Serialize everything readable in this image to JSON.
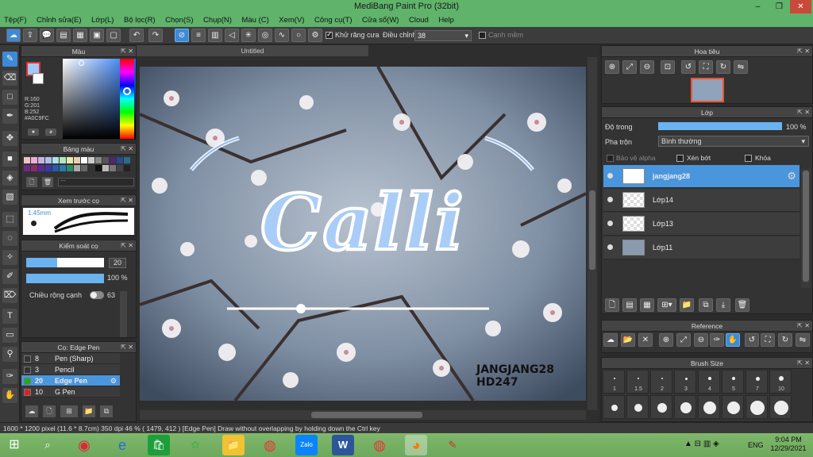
{
  "titlebar": {
    "title": "MediBang Paint Pro (32bit)",
    "minimize": "–",
    "maximize": "❐",
    "close": "✕"
  },
  "menu": [
    "Tệp(F)",
    "Chỉnh sửa(E)",
    "Lớp(L)",
    "Bộ lọc(R)",
    "Chọn(S)",
    "Chụp(N)",
    "Màu (C)",
    "Xem(V)",
    "Công cụ(T)",
    "Cửa sổ(W)",
    "Cloud",
    "Help"
  ],
  "toolbar": {
    "antialias_label": "Khử răng cưa",
    "adjust_label": "Điều chỉnh",
    "adjust_value": "38",
    "smooth_label": "Cạnh mềm"
  },
  "color_panel": {
    "title": "Màu",
    "r": "R:160",
    "g": "G:201",
    "b": "B:252",
    "hex": "#A0C9FC",
    "accent": "#a0c9fc"
  },
  "palette_panel": {
    "title": "Bảng màu"
  },
  "preview_panel": {
    "title": "Xem trước cọ",
    "size": "1.45mm"
  },
  "control_panel": {
    "title": "Kiểm soát cọ",
    "size_value": "20",
    "opacity_value": "100 %",
    "width_label": "Chiều rộng cạnh",
    "width_value": "63"
  },
  "brush_panel": {
    "title": "Cọ: Edge Pen",
    "items": [
      {
        "num": "8",
        "name": "Pen (Sharp)",
        "color": "#333333"
      },
      {
        "num": "3",
        "name": "Pencil",
        "color": "#333333"
      },
      {
        "num": "20",
        "name": "Edge Pen",
        "color": "#22aa22"
      },
      {
        "num": "10",
        "name": "G Pen",
        "color": "#dd2222"
      }
    ]
  },
  "document": {
    "tab": "Untitled"
  },
  "artwork": {
    "title": "Calli",
    "watermark_line1": "JANGJANG28",
    "watermark_line2": "HD247"
  },
  "navigator": {
    "title": "Hoa tiêu"
  },
  "layer_panel": {
    "title": "Lớp",
    "opacity_label": "Độ trong",
    "opacity_value": "100 %",
    "blend_label": "Pha trộn",
    "blend_value": "Bình thường",
    "protect_alpha": "Bảo vệ alpha",
    "clip": "Xén bớt",
    "lock": "Khóa",
    "layers": [
      {
        "name": "jangjang28"
      },
      {
        "name": "Lớp14"
      },
      {
        "name": "Lớp13"
      },
      {
        "name": "Lớp11"
      }
    ]
  },
  "reference_panel": {
    "title": "Reference"
  },
  "brush_size_panel": {
    "title": "Brush Size",
    "labels": [
      "1",
      "1.5",
      "2",
      "3",
      "4",
      "5",
      "7",
      "10"
    ]
  },
  "status": {
    "text": "1600 * 1200 pixel   (11.6 * 8.7cm)   350 dpi   46 %   ( 1479, 412 )   [Edge Pen] Draw without overlapping by holding down the Ctrl key"
  },
  "taskbar": {
    "lang": "ENG",
    "time": "9:04 PM",
    "date": "12/29/2021"
  }
}
